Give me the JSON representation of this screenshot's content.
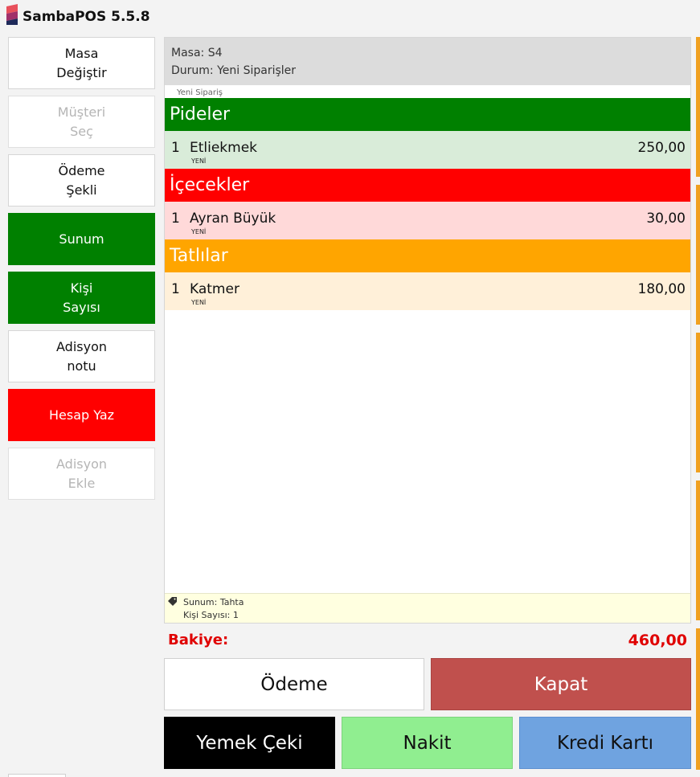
{
  "app": {
    "title": "SambaPOS 5.5.8"
  },
  "sidebar": {
    "buttons": [
      {
        "label": "Masa\nDeğiştir",
        "state": "normal"
      },
      {
        "label": "Müşteri\nSeç",
        "state": "disabled"
      },
      {
        "label": "Ödeme\nŞekli",
        "state": "normal"
      },
      {
        "label": "Sunum",
        "state": "green"
      },
      {
        "label": "Kişi\nSayısı",
        "state": "green"
      },
      {
        "label": "Adisyon\nnotu",
        "state": "normal"
      },
      {
        "label": "Hesap Yaz",
        "state": "red"
      },
      {
        "label": "Adisyon\nEkle",
        "state": "disabled"
      }
    ]
  },
  "ticket": {
    "table": "Masa: S4",
    "status": "Durum: Yeni Siparişler",
    "order_tag": "Yeni Sipariş",
    "groups": [
      {
        "name": "Pideler",
        "color": "#008000",
        "row_color": "#d9ecd9",
        "items": [
          {
            "qty": "1",
            "name": "Etliekmek",
            "status": "YENİ",
            "price": "250,00"
          }
        ]
      },
      {
        "name": "İçecekler",
        "color": "#ff0000",
        "row_color": "#ffd9d9",
        "items": [
          {
            "qty": "1",
            "name": "Ayran Büyük",
            "status": "YENİ",
            "price": "30,00"
          }
        ]
      },
      {
        "name": "Tatlılar",
        "color": "#ffa500",
        "row_color": "#fff0d9",
        "items": [
          {
            "qty": "1",
            "name": "Katmer",
            "status": "YENİ",
            "price": "180,00"
          }
        ]
      }
    ],
    "notes": {
      "icon": "tag-icon",
      "lines": [
        "Sunum: Tahta",
        "Kişi Sayısı: 1"
      ]
    }
  },
  "balance": {
    "label": "Bakiye:",
    "value": "460,00",
    "color": "#e00000"
  },
  "actions": {
    "odeme": "Ödeme",
    "kapat": "Kapat",
    "yemek_ceki": "Yemek Çeki",
    "nakit": "Nakit",
    "kredi_karti": "Kredi Kartı"
  }
}
